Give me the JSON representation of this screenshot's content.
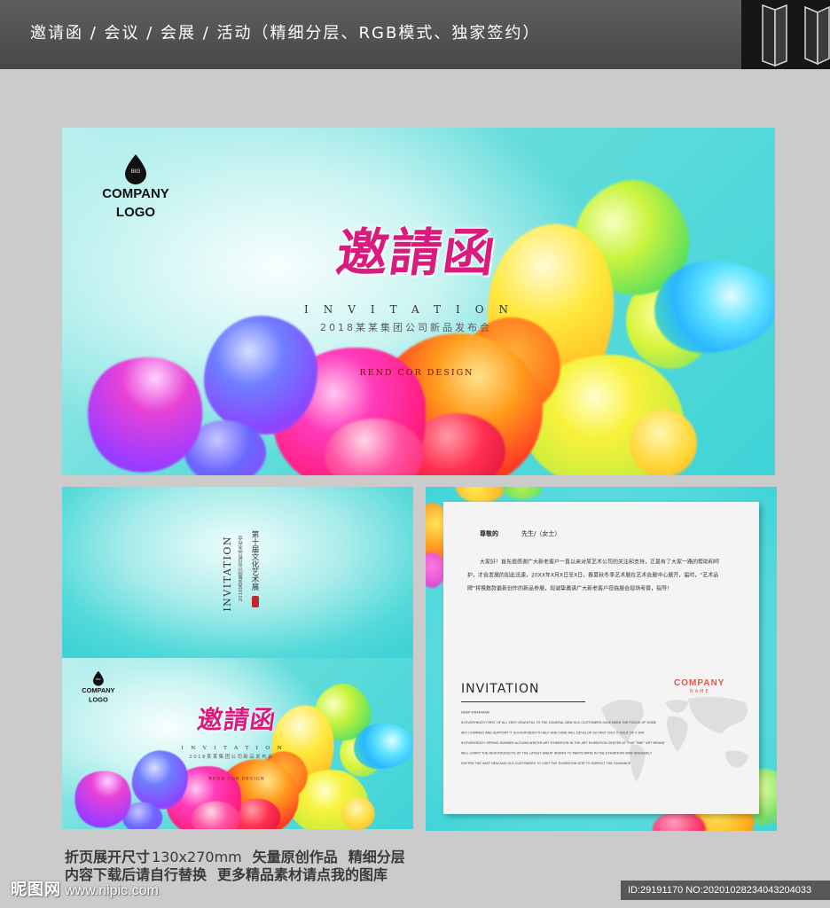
{
  "header": {
    "title": "邀请函 / 会议 / 会展 / 活动（精细分层、RGB模式、独家签约）"
  },
  "cover": {
    "logo": {
      "mark": "BIG",
      "line1": "COMPANY",
      "line2": "LOGO"
    },
    "title": "邀請函",
    "subtitle": "INVITATION",
    "event": "2018某某集团公司新品发布会",
    "designer": "REND COR DESIGN"
  },
  "inner_left": {
    "vertical_title": "第十届文化艺术展",
    "vertical_en": "INVITATION",
    "vertical_small": "2018某某集团公司新品发布会"
  },
  "letter": {
    "salutation": "尊敬的",
    "salutation_suffix": "先生/（女士）",
    "body": "大家好！首先很感谢广大新老客户一直以来对某艺术公司的关注和支持，正是有了大家一路的帮助和呵护，才会发展的如此迅速，20XX年X月X日至X日，春夏秋冬季艺术展在艺术会展中心展开，届时，“艺术品牌”将携数款最新创作的新品参展，现诚挚邀请广大新老客户莅临展会现场考察，指导!",
    "heading": "INVITATION",
    "company": "COMPANY",
    "company_sub": "NAME",
    "en_lines": [
      "DEAR SIR/MADAM",
      "IN EVERYBODY FIRST OF ALL VERY GRATEFUL TO THE GENERAL NEW OLD CUSTOMERS HAVE BEEN THE FOCUS OF SOME",
      "ART COMPANY AND SUPPORT IT IS EVERYBODY'S HELP AND CARE WILL DEVELOP SO FAST 20XX X SOLIT OF X DAY",
      "IN EVERYBODY SPRING SUMMER AUTUMN WINTER ART EXHIBITION IN THE ART EXHIBITION CENTER AT THAT TIME \"ART BRAND\"",
      "WILL CARRY THE NEW PRODUCTS OF THE LATEST GREAT WORKS TO PARTICIPATE IN THE EXHIBITION NOW SINCERELY",
      "INVITED THE VAST NEW AND OLD CUSTOMERS TO VISIT THE EXHIBITION SITE TO INSPECT THE GUIDANCE"
    ]
  },
  "footer": {
    "size_label": "折页展开尺寸",
    "size_value": "130x270mm",
    "tag1": "矢量原创作品",
    "tag2": "精细分层",
    "note1": "内容下载后请自行替换",
    "note2": "更多精品素材请点我的图库"
  },
  "watermark": {
    "brand": "昵图网",
    "url": "www.nipic.com",
    "id": "ID:29191170 NO:20201028234043204033"
  },
  "colors": {
    "teal": "#3fd4d8",
    "title_magenta": "#d81b7d",
    "company_red": "#e0574f",
    "header_bg": "#4a4a4a",
    "page_bg": "#cbcbcb"
  }
}
